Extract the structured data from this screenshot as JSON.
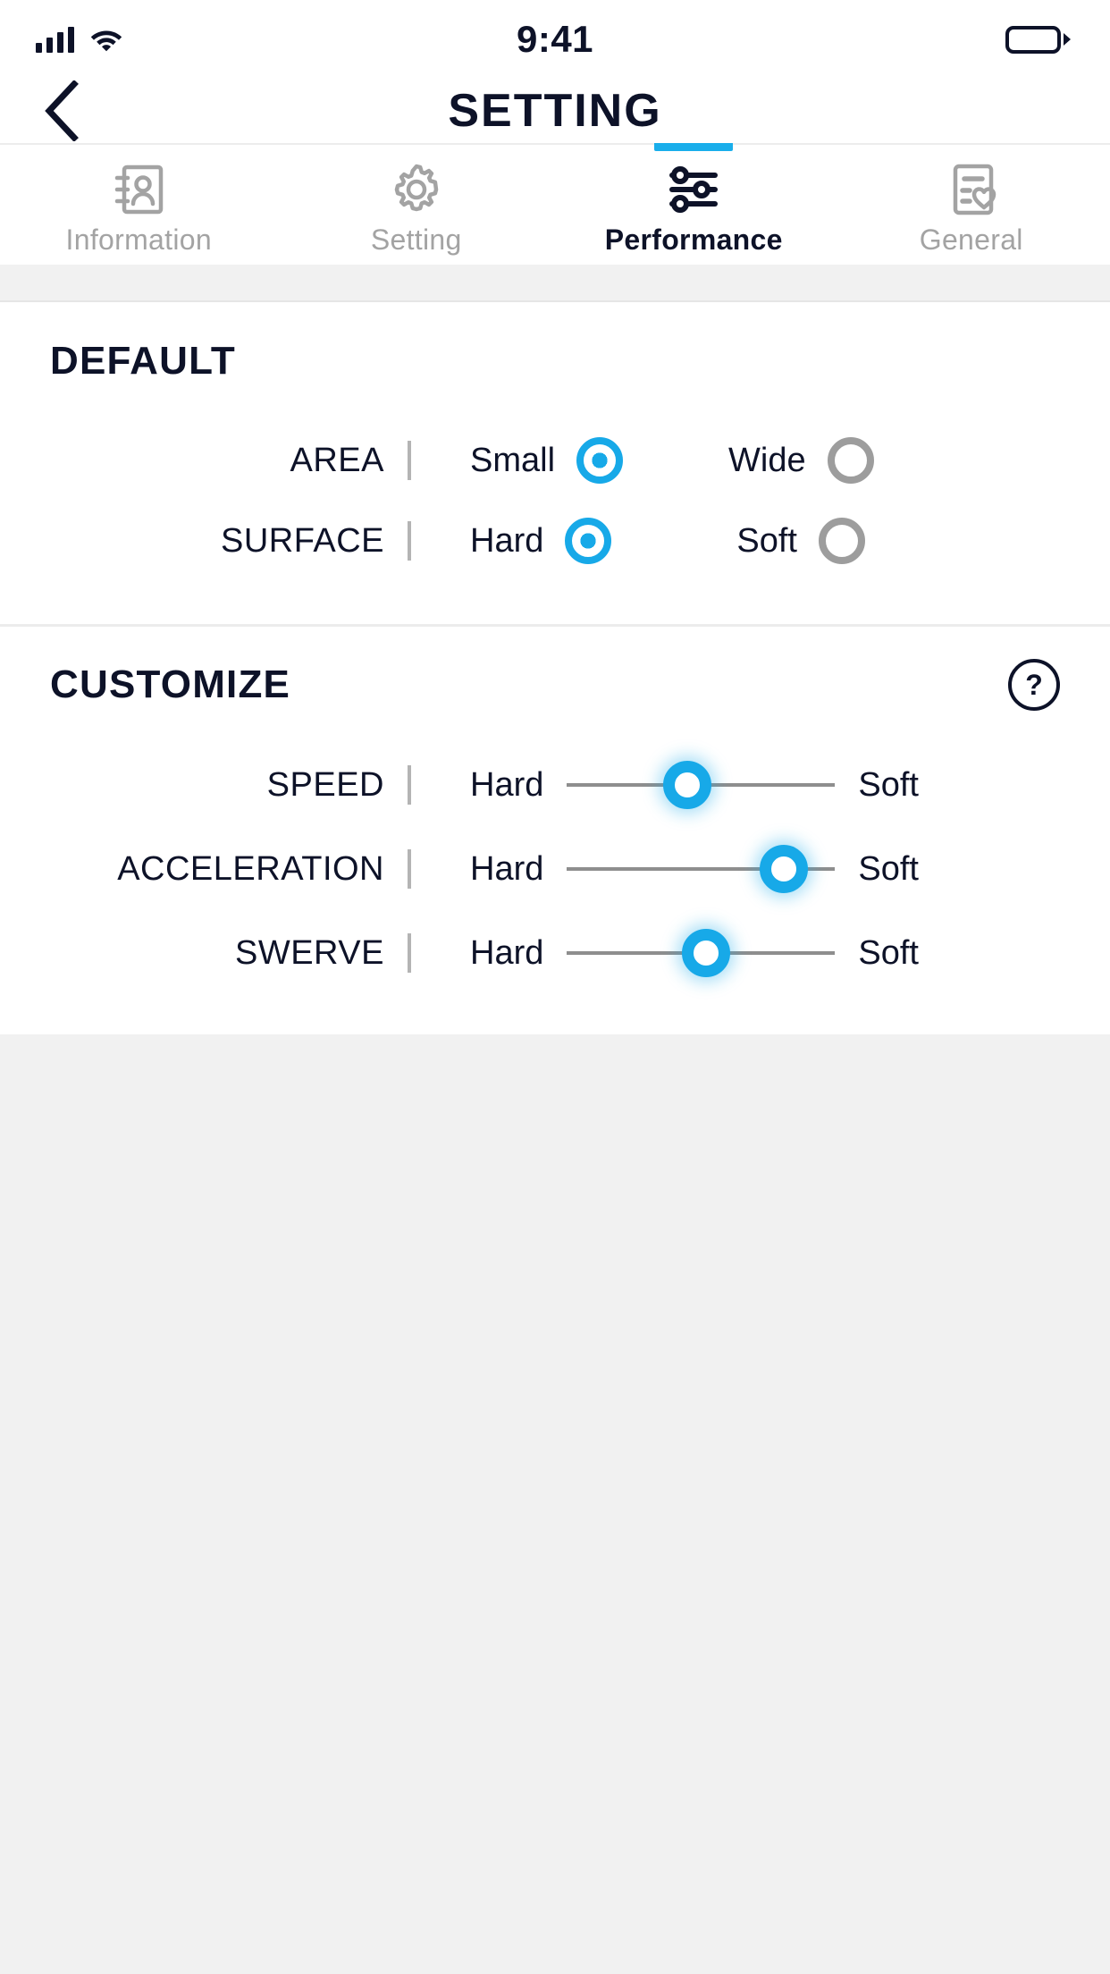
{
  "statusbar": {
    "time": "9:41",
    "signal_icon": "cellular-signal-icon",
    "wifi_icon": "wifi-icon",
    "battery_icon": "battery-full-icon"
  },
  "header": {
    "title": "SETTING",
    "back_icon": "chevron-left-icon"
  },
  "tabs": [
    {
      "label": "Information",
      "icon": "contact-book-icon",
      "active": false
    },
    {
      "label": "Setting",
      "icon": "gear-icon",
      "active": false
    },
    {
      "label": "Performance",
      "icon": "sliders-icon",
      "active": true
    },
    {
      "label": "General",
      "icon": "document-heart-icon",
      "active": false
    }
  ],
  "accent_color": "#17a9e8",
  "text_color": "#0d1228",
  "muted_color": "#a3a3a3",
  "sections": {
    "default": {
      "title": "DEFAULT",
      "rows": [
        {
          "label": "AREA",
          "options": [
            {
              "text": "Small",
              "selected": true
            },
            {
              "text": "Wide",
              "selected": false
            }
          ]
        },
        {
          "label": "SURFACE",
          "options": [
            {
              "text": "Hard",
              "selected": true
            },
            {
              "text": "Soft",
              "selected": false
            }
          ]
        }
      ]
    },
    "customize": {
      "title": "CUSTOMIZE",
      "help_label": "?",
      "help_icon": "question-circle-icon",
      "rows": [
        {
          "label": "SPEED",
          "left": "Hard",
          "right": "Soft",
          "value": 45
        },
        {
          "label": "ACCELERATION",
          "left": "Hard",
          "right": "Soft",
          "value": 81
        },
        {
          "label": "SWERVE",
          "left": "Hard",
          "right": "Soft",
          "value": 52
        }
      ]
    }
  }
}
